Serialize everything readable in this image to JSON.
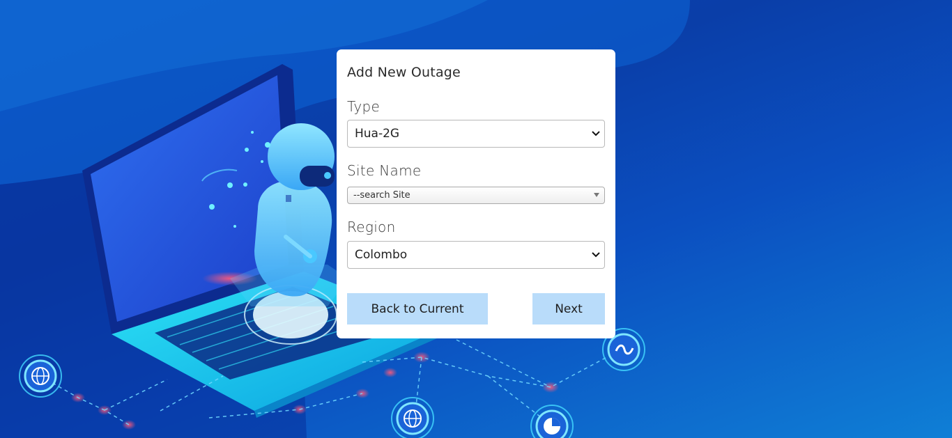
{
  "form": {
    "title": "Add New Outage",
    "type_label": "Type",
    "type_value": "Hua-2G",
    "site_label": "Site Name",
    "site_placeholder": "--search Site",
    "region_label": "Region",
    "region_value": "Colombo",
    "back_button": "Back to Current",
    "next_button": "Next"
  },
  "colors": {
    "background": "#0a47b8",
    "card": "#ffffff",
    "button": "#b9dcfa"
  },
  "icons": [
    "chevron-down-icon",
    "laptop-illustration",
    "robot-illustration",
    "globe-icon",
    "pie-chart-icon",
    "chat-wave-icon"
  ]
}
